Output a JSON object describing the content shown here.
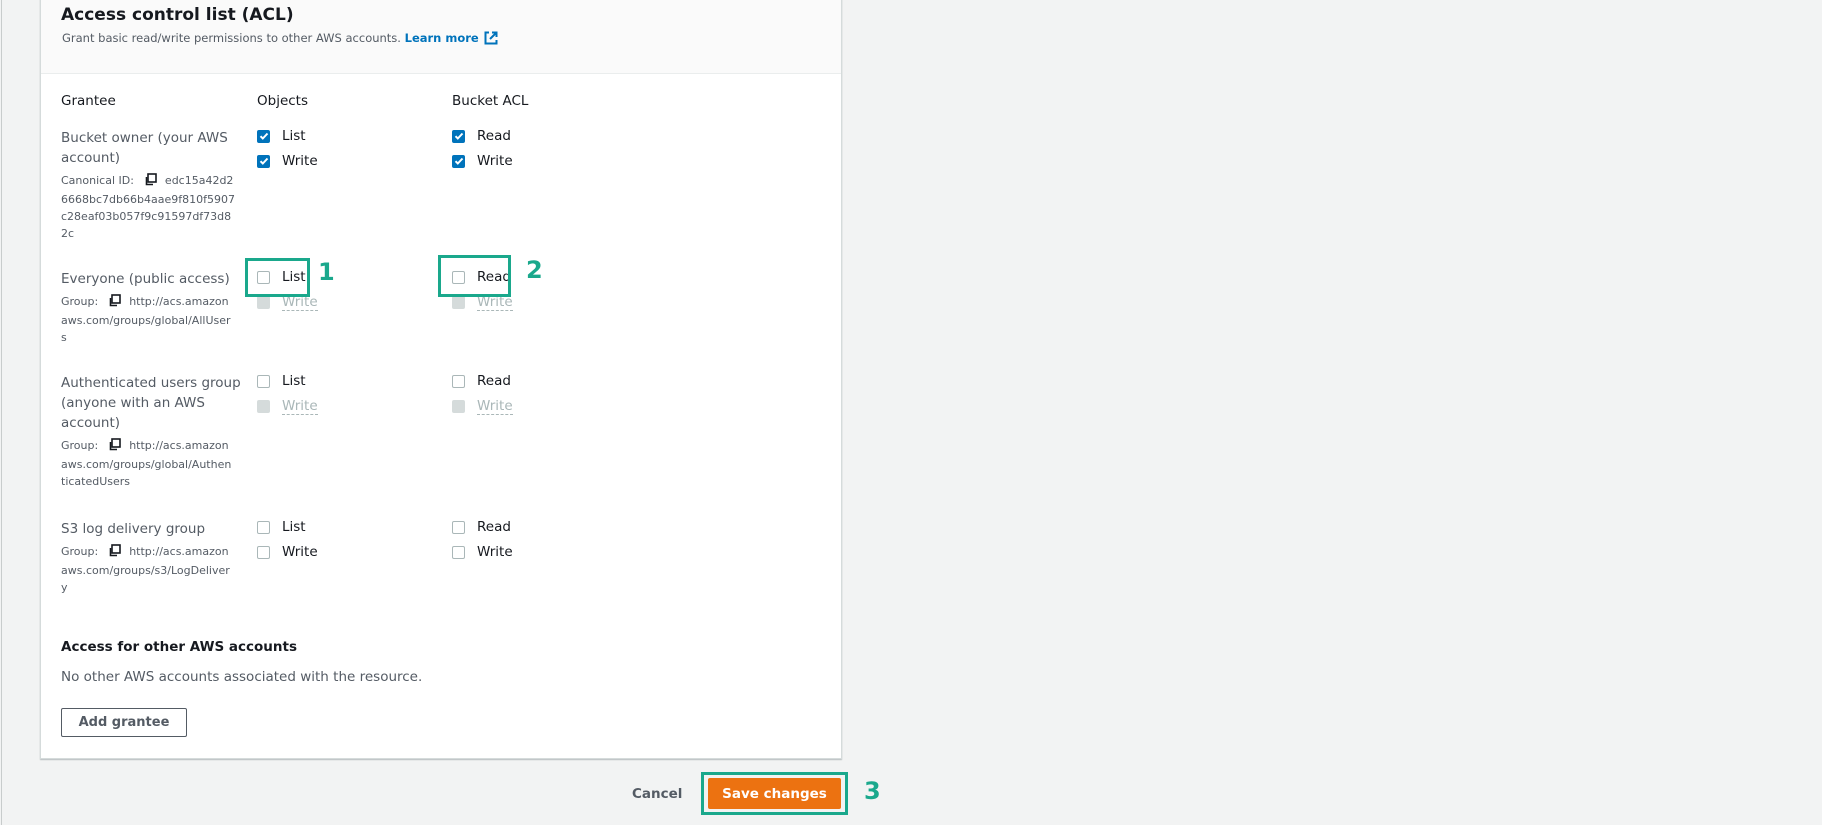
{
  "acl": {
    "title": "Access control list (ACL)",
    "description": "Grant basic read/write permissions to other AWS accounts.",
    "learn_more": "Learn more",
    "columns": {
      "grantee": "Grantee",
      "objects": "Objects",
      "bucket_acl": "Bucket ACL"
    },
    "grantees": [
      {
        "name": "Bucket owner (your AWS account)",
        "meta_label": "Canonical ID:",
        "meta_value": "edc15a42d26668bc7db66b4aae9f810f5907c28eaf03b057f9c91597df73d82c",
        "objects": [
          {
            "label": "List",
            "checked": true,
            "disabled": false
          },
          {
            "label": "Write",
            "checked": true,
            "disabled": false
          }
        ],
        "bucket_acl": [
          {
            "label": "Read",
            "checked": true,
            "disabled": false
          },
          {
            "label": "Write",
            "checked": true,
            "disabled": false
          }
        ]
      },
      {
        "name": "Everyone (public access)",
        "meta_label": "Group:",
        "meta_value": "http://acs.amazonaws.com/groups/global/AllUsers",
        "objects": [
          {
            "label": "List",
            "checked": false,
            "disabled": false
          },
          {
            "label": "Write",
            "checked": false,
            "disabled": true
          }
        ],
        "bucket_acl": [
          {
            "label": "Read",
            "checked": false,
            "disabled": false
          },
          {
            "label": "Write",
            "checked": false,
            "disabled": true
          }
        ]
      },
      {
        "name": "Authenticated users group (anyone with an AWS account)",
        "meta_label": "Group:",
        "meta_value": "http://acs.amazonaws.com/groups/global/AuthenticatedUsers",
        "objects": [
          {
            "label": "List",
            "checked": false,
            "disabled": false
          },
          {
            "label": "Write",
            "checked": false,
            "disabled": true
          }
        ],
        "bucket_acl": [
          {
            "label": "Read",
            "checked": false,
            "disabled": false
          },
          {
            "label": "Write",
            "checked": false,
            "disabled": true
          }
        ]
      },
      {
        "name": "S3 log delivery group",
        "meta_label": "Group:",
        "meta_value": "http://acs.amazonaws.com/groups/s3/LogDelivery",
        "objects": [
          {
            "label": "List",
            "checked": false,
            "disabled": false
          },
          {
            "label": "Write",
            "checked": false,
            "disabled": false
          }
        ],
        "bucket_acl": [
          {
            "label": "Read",
            "checked": false,
            "disabled": false
          },
          {
            "label": "Write",
            "checked": false,
            "disabled": false
          }
        ]
      }
    ],
    "other_accounts": {
      "title": "Access for other AWS accounts",
      "empty_text": "No other AWS accounts associated with the resource.",
      "add_button": "Add grantee"
    }
  },
  "footer": {
    "cancel": "Cancel",
    "save": "Save changes"
  },
  "annotations": [
    "1",
    "2",
    "3"
  ],
  "colors": {
    "primary": "#ec7211",
    "checkbox_checked": "#0073bb",
    "link": "#0073bb",
    "annotation": "#1aa88c"
  }
}
